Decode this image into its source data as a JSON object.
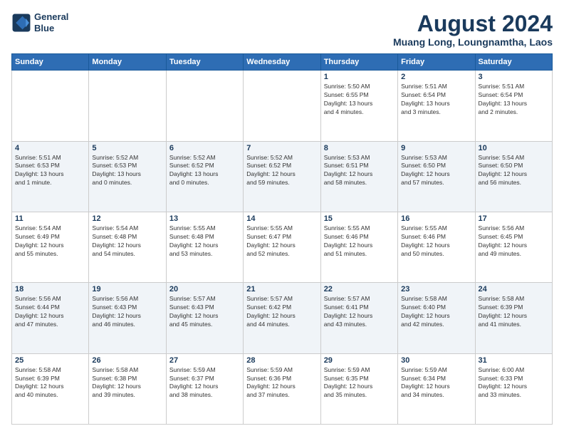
{
  "logo": {
    "line1": "General",
    "line2": "Blue"
  },
  "title": "August 2024",
  "subtitle": "Muang Long, Loungnamtha, Laos",
  "days_of_week": [
    "Sunday",
    "Monday",
    "Tuesday",
    "Wednesday",
    "Thursday",
    "Friday",
    "Saturday"
  ],
  "weeks": [
    [
      {
        "day": "",
        "info": ""
      },
      {
        "day": "",
        "info": ""
      },
      {
        "day": "",
        "info": ""
      },
      {
        "day": "",
        "info": ""
      },
      {
        "day": "1",
        "info": "Sunrise: 5:50 AM\nSunset: 6:55 PM\nDaylight: 13 hours\nand 4 minutes."
      },
      {
        "day": "2",
        "info": "Sunrise: 5:51 AM\nSunset: 6:54 PM\nDaylight: 13 hours\nand 3 minutes."
      },
      {
        "day": "3",
        "info": "Sunrise: 5:51 AM\nSunset: 6:54 PM\nDaylight: 13 hours\nand 2 minutes."
      }
    ],
    [
      {
        "day": "4",
        "info": "Sunrise: 5:51 AM\nSunset: 6:53 PM\nDaylight: 13 hours\nand 1 minute."
      },
      {
        "day": "5",
        "info": "Sunrise: 5:52 AM\nSunset: 6:53 PM\nDaylight: 13 hours\nand 0 minutes."
      },
      {
        "day": "6",
        "info": "Sunrise: 5:52 AM\nSunset: 6:52 PM\nDaylight: 13 hours\nand 0 minutes."
      },
      {
        "day": "7",
        "info": "Sunrise: 5:52 AM\nSunset: 6:52 PM\nDaylight: 12 hours\nand 59 minutes."
      },
      {
        "day": "8",
        "info": "Sunrise: 5:53 AM\nSunset: 6:51 PM\nDaylight: 12 hours\nand 58 minutes."
      },
      {
        "day": "9",
        "info": "Sunrise: 5:53 AM\nSunset: 6:50 PM\nDaylight: 12 hours\nand 57 minutes."
      },
      {
        "day": "10",
        "info": "Sunrise: 5:54 AM\nSunset: 6:50 PM\nDaylight: 12 hours\nand 56 minutes."
      }
    ],
    [
      {
        "day": "11",
        "info": "Sunrise: 5:54 AM\nSunset: 6:49 PM\nDaylight: 12 hours\nand 55 minutes."
      },
      {
        "day": "12",
        "info": "Sunrise: 5:54 AM\nSunset: 6:48 PM\nDaylight: 12 hours\nand 54 minutes."
      },
      {
        "day": "13",
        "info": "Sunrise: 5:55 AM\nSunset: 6:48 PM\nDaylight: 12 hours\nand 53 minutes."
      },
      {
        "day": "14",
        "info": "Sunrise: 5:55 AM\nSunset: 6:47 PM\nDaylight: 12 hours\nand 52 minutes."
      },
      {
        "day": "15",
        "info": "Sunrise: 5:55 AM\nSunset: 6:46 PM\nDaylight: 12 hours\nand 51 minutes."
      },
      {
        "day": "16",
        "info": "Sunrise: 5:55 AM\nSunset: 6:46 PM\nDaylight: 12 hours\nand 50 minutes."
      },
      {
        "day": "17",
        "info": "Sunrise: 5:56 AM\nSunset: 6:45 PM\nDaylight: 12 hours\nand 49 minutes."
      }
    ],
    [
      {
        "day": "18",
        "info": "Sunrise: 5:56 AM\nSunset: 6:44 PM\nDaylight: 12 hours\nand 47 minutes."
      },
      {
        "day": "19",
        "info": "Sunrise: 5:56 AM\nSunset: 6:43 PM\nDaylight: 12 hours\nand 46 minutes."
      },
      {
        "day": "20",
        "info": "Sunrise: 5:57 AM\nSunset: 6:43 PM\nDaylight: 12 hours\nand 45 minutes."
      },
      {
        "day": "21",
        "info": "Sunrise: 5:57 AM\nSunset: 6:42 PM\nDaylight: 12 hours\nand 44 minutes."
      },
      {
        "day": "22",
        "info": "Sunrise: 5:57 AM\nSunset: 6:41 PM\nDaylight: 12 hours\nand 43 minutes."
      },
      {
        "day": "23",
        "info": "Sunrise: 5:58 AM\nSunset: 6:40 PM\nDaylight: 12 hours\nand 42 minutes."
      },
      {
        "day": "24",
        "info": "Sunrise: 5:58 AM\nSunset: 6:39 PM\nDaylight: 12 hours\nand 41 minutes."
      }
    ],
    [
      {
        "day": "25",
        "info": "Sunrise: 5:58 AM\nSunset: 6:39 PM\nDaylight: 12 hours\nand 40 minutes."
      },
      {
        "day": "26",
        "info": "Sunrise: 5:58 AM\nSunset: 6:38 PM\nDaylight: 12 hours\nand 39 minutes."
      },
      {
        "day": "27",
        "info": "Sunrise: 5:59 AM\nSunset: 6:37 PM\nDaylight: 12 hours\nand 38 minutes."
      },
      {
        "day": "28",
        "info": "Sunrise: 5:59 AM\nSunset: 6:36 PM\nDaylight: 12 hours\nand 37 minutes."
      },
      {
        "day": "29",
        "info": "Sunrise: 5:59 AM\nSunset: 6:35 PM\nDaylight: 12 hours\nand 35 minutes."
      },
      {
        "day": "30",
        "info": "Sunrise: 5:59 AM\nSunset: 6:34 PM\nDaylight: 12 hours\nand 34 minutes."
      },
      {
        "day": "31",
        "info": "Sunrise: 6:00 AM\nSunset: 6:33 PM\nDaylight: 12 hours\nand 33 minutes."
      }
    ]
  ]
}
